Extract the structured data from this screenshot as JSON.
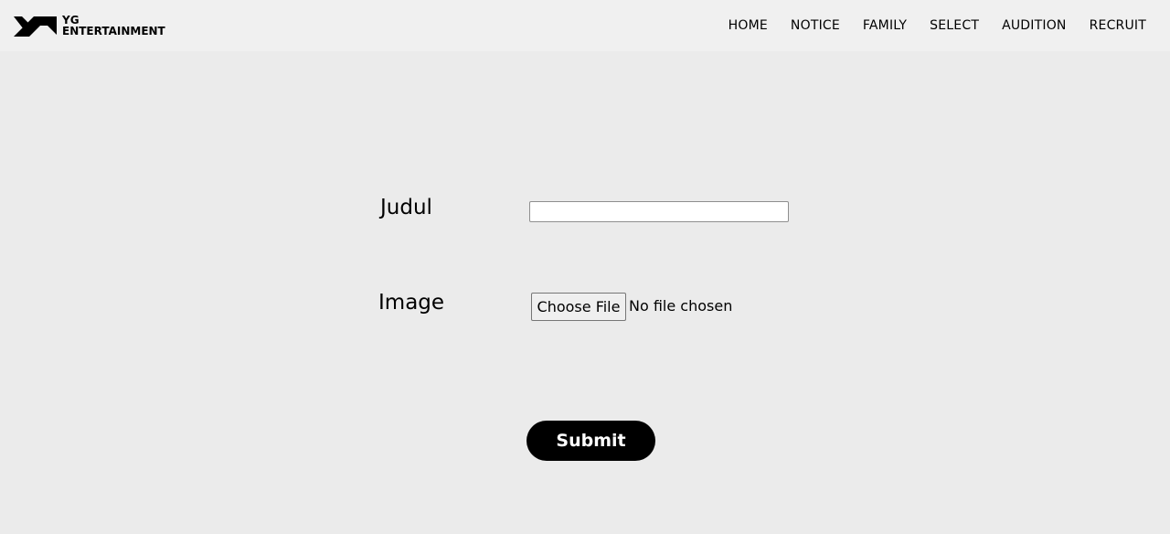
{
  "header": {
    "logo": {
      "line1": "YG",
      "line2": "ENTERTAINMENT"
    },
    "nav": [
      "HOME",
      "NOTICE",
      "FAMILY",
      "SELECT",
      "AUDITION",
      "RECRUIT"
    ]
  },
  "form": {
    "judul_label": "Judul",
    "judul_value": "",
    "image_label": "Image",
    "file_button_label": "Choose File",
    "file_status": "No file chosen",
    "submit_label": "Submit"
  },
  "colors": {
    "page_background": "#ebebeb",
    "navbar_background": "#f0f0f0",
    "submit_background": "#000000",
    "submit_text": "#ffffff"
  }
}
